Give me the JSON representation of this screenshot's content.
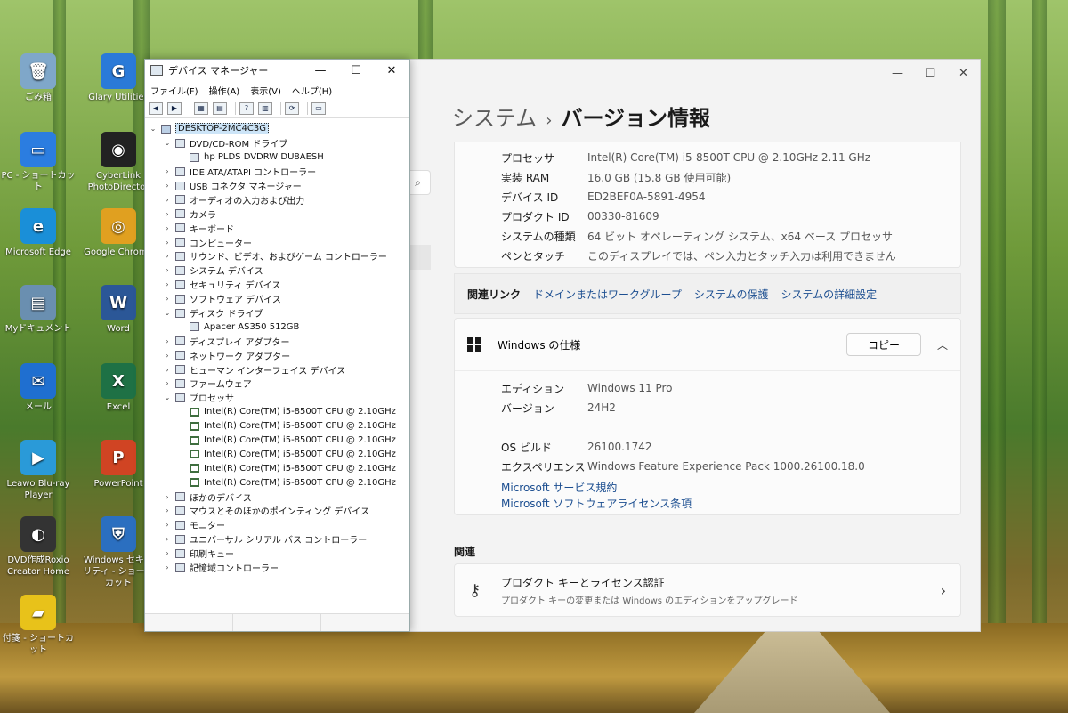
{
  "desktop": {
    "icons": [
      {
        "label": "ごみ箱",
        "color": "#7fa7c9",
        "glyph": "🗑"
      },
      {
        "label": "Glary Utilities",
        "color": "#2a7ad8",
        "glyph": "G"
      },
      {
        "label": "PC - ショートカット",
        "color": "#2b7de0",
        "glyph": "▭"
      },
      {
        "label": "CyberLink PhotoDirector",
        "color": "#222222",
        "glyph": "◉"
      },
      {
        "label": "Microsoft Edge",
        "color": "#1a8fd8",
        "glyph": "e"
      },
      {
        "label": "Google Chrome",
        "color": "#e0a020",
        "glyph": "◎"
      },
      {
        "label": "Myドキュメント",
        "color": "#6a8fb0",
        "glyph": "▤"
      },
      {
        "label": "Word",
        "color": "#2b5797",
        "glyph": "W"
      },
      {
        "label": "メール",
        "color": "#1f6fd0",
        "glyph": "✉"
      },
      {
        "label": "Excel",
        "color": "#1e7145",
        "glyph": "X"
      },
      {
        "label": "Leawo Blu-ray Player",
        "color": "#2a9ad8",
        "glyph": "▶"
      },
      {
        "label": "PowerPoint",
        "color": "#d04423",
        "glyph": "P"
      },
      {
        "label": "DVD作成Roxio Creator Home",
        "color": "#333333",
        "glyph": "◐"
      },
      {
        "label": "Windows セキュリティ - ショートカット",
        "color": "#2b6fc0",
        "glyph": "⛨"
      },
      {
        "label": "付箋 - ショートカット",
        "color": "#e8c21a",
        "glyph": "▰"
      }
    ]
  },
  "settings": {
    "breadcrumb_parent": "システム",
    "breadcrumb_sep": "›",
    "breadcrumb_current": "バージョン情報",
    "device_specs": [
      {
        "key": "プロセッサ",
        "value": "Intel(R) Core(TM) i5-8500T CPU @ 2.10GHz   2.11 GHz"
      },
      {
        "key": "実装 RAM",
        "value": "16.0 GB (15.8 GB 使用可能)"
      },
      {
        "key": "デバイス ID",
        "value": "ED2BEF0A-5891-4954"
      },
      {
        "key": "プロダクト ID",
        "value": "00330-81609"
      },
      {
        "key": "システムの種類",
        "value": "64 ビット オペレーティング システム、x64 ベース プロセッサ"
      },
      {
        "key": "ペンとタッチ",
        "value": "このディスプレイでは、ペン入力とタッチ入力は利用できません"
      }
    ],
    "related_links_label": "関連リンク",
    "related_links": [
      "ドメインまたはワークグループ",
      "システムの保護",
      "システムの詳細設定"
    ],
    "windows_spec_title": "Windows の仕様",
    "copy_label": "コピー",
    "windows_specs": [
      {
        "key": "エディション",
        "value": "Windows 11 Pro"
      },
      {
        "key": "バージョン",
        "value": "24H2"
      },
      {
        "key": "OS ビルド",
        "value": "26100.1742"
      },
      {
        "key": "エクスペリエンス",
        "value": "Windows Feature Experience Pack 1000.26100.18.0"
      }
    ],
    "links": [
      "Microsoft サービス規約",
      "Microsoft ソフトウェアライセンス条項"
    ],
    "related_title": "関連",
    "product_key_title": "プロダクト キーとライセンス認証",
    "product_key_sub": "プロダクト キーの変更または Windows のエディションをアップグレード"
  },
  "devmgr": {
    "title": "デバイス マネージャー",
    "menu": [
      "ファイル(F)",
      "操作(A)",
      "表示(V)",
      "ヘルプ(H)"
    ],
    "tree": [
      {
        "label": "DESKTOP-2MC4C3G",
        "level": 0,
        "toggle": "⌄",
        "kind": "root",
        "selected": true
      },
      {
        "label": "DVD/CD-ROM ドライブ",
        "level": 1,
        "toggle": "⌄",
        "kind": "cat"
      },
      {
        "label": "hp PLDS DVDRW  DU8AESH",
        "level": 2,
        "toggle": "",
        "kind": "dev"
      },
      {
        "label": "IDE ATA/ATAPI コントローラー",
        "level": 1,
        "toggle": "›",
        "kind": "cat"
      },
      {
        "label": "USB コネクタ マネージャー",
        "level": 1,
        "toggle": "›",
        "kind": "cat"
      },
      {
        "label": "オーディオの入力および出力",
        "level": 1,
        "toggle": "›",
        "kind": "cat"
      },
      {
        "label": "カメラ",
        "level": 1,
        "toggle": "›",
        "kind": "cat"
      },
      {
        "label": "キーボード",
        "level": 1,
        "toggle": "›",
        "kind": "cat"
      },
      {
        "label": "コンピューター",
        "level": 1,
        "toggle": "›",
        "kind": "cat"
      },
      {
        "label": "サウンド、ビデオ、およびゲーム コントローラー",
        "level": 1,
        "toggle": "›",
        "kind": "cat"
      },
      {
        "label": "システム デバイス",
        "level": 1,
        "toggle": "›",
        "kind": "cat"
      },
      {
        "label": "セキュリティ デバイス",
        "level": 1,
        "toggle": "›",
        "kind": "cat"
      },
      {
        "label": "ソフトウェア デバイス",
        "level": 1,
        "toggle": "›",
        "kind": "cat"
      },
      {
        "label": "ディスク ドライブ",
        "level": 1,
        "toggle": "⌄",
        "kind": "cat"
      },
      {
        "label": "Apacer AS350 512GB",
        "level": 2,
        "toggle": "",
        "kind": "dev"
      },
      {
        "label": "ディスプレイ アダプター",
        "level": 1,
        "toggle": "›",
        "kind": "cat"
      },
      {
        "label": "ネットワーク アダプター",
        "level": 1,
        "toggle": "›",
        "kind": "cat"
      },
      {
        "label": "ヒューマン インターフェイス デバイス",
        "level": 1,
        "toggle": "›",
        "kind": "cat"
      },
      {
        "label": "ファームウェア",
        "level": 1,
        "toggle": "›",
        "kind": "cat"
      },
      {
        "label": "プロセッサ",
        "level": 1,
        "toggle": "⌄",
        "kind": "cat"
      },
      {
        "label": "Intel(R) Core(TM) i5-8500T CPU @ 2.10GHz",
        "level": 2,
        "toggle": "",
        "kind": "cpu"
      },
      {
        "label": "Intel(R) Core(TM) i5-8500T CPU @ 2.10GHz",
        "level": 2,
        "toggle": "",
        "kind": "cpu"
      },
      {
        "label": "Intel(R) Core(TM) i5-8500T CPU @ 2.10GHz",
        "level": 2,
        "toggle": "",
        "kind": "cpu"
      },
      {
        "label": "Intel(R) Core(TM) i5-8500T CPU @ 2.10GHz",
        "level": 2,
        "toggle": "",
        "kind": "cpu"
      },
      {
        "label": "Intel(R) Core(TM) i5-8500T CPU @ 2.10GHz",
        "level": 2,
        "toggle": "",
        "kind": "cpu"
      },
      {
        "label": "Intel(R) Core(TM) i5-8500T CPU @ 2.10GHz",
        "level": 2,
        "toggle": "",
        "kind": "cpu"
      },
      {
        "label": "ほかのデバイス",
        "level": 1,
        "toggle": "›",
        "kind": "cat"
      },
      {
        "label": "マウスとそのほかのポインティング デバイス",
        "level": 1,
        "toggle": "›",
        "kind": "cat"
      },
      {
        "label": "モニター",
        "level": 1,
        "toggle": "›",
        "kind": "cat"
      },
      {
        "label": "ユニバーサル シリアル バス コントローラー",
        "level": 1,
        "toggle": "›",
        "kind": "cat"
      },
      {
        "label": "印刷キュー",
        "level": 1,
        "toggle": "›",
        "kind": "cat"
      },
      {
        "label": "記憶域コントローラー",
        "level": 1,
        "toggle": "›",
        "kind": "cat"
      }
    ]
  }
}
